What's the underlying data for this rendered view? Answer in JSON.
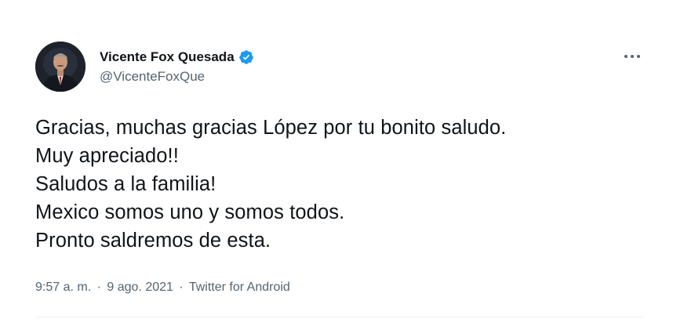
{
  "author": {
    "display_name": "Vicente Fox Quesada",
    "handle": "@VicenteFoxQue",
    "verified": true
  },
  "tweet": {
    "lines": [
      "Gracias, muchas gracias López por tu bonito saludo.",
      "Muy apreciado!!",
      "Saludos a la familia!",
      "Mexico somos uno y somos todos.",
      "Pronto saldremos de esta."
    ],
    "time": "9:57 a. m.",
    "separator": "·",
    "date": "9 ago. 2021",
    "source": "Twitter for Android"
  },
  "colors": {
    "text": "#0f1419",
    "secondary": "#536471",
    "verified_blue": "#1d9bf0",
    "divider": "#eff3f4"
  },
  "icons": {
    "verified": "verified-badge-icon",
    "more": "more-options-icon"
  }
}
